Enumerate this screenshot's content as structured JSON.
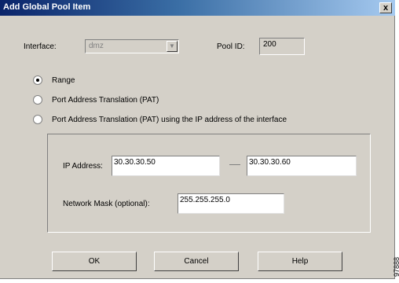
{
  "window": {
    "title": "Add Global Pool Item",
    "close_label": "x"
  },
  "interface": {
    "label": "Interface:",
    "value": "dmz",
    "arrow": "▼"
  },
  "pool": {
    "label": "Pool ID:",
    "value": "200"
  },
  "options": [
    {
      "label": "Range",
      "checked": true
    },
    {
      "label": "Port Address Translation (PAT)",
      "checked": false
    },
    {
      "label": "Port Address Translation (PAT) using the IP address of the interface",
      "checked": false
    }
  ],
  "ip": {
    "label": "IP Address:",
    "start": "30.30.30.50",
    "end": "30.30.30.60"
  },
  "mask": {
    "label": "Network Mask (optional):",
    "value": "255.255.255.0"
  },
  "buttons": {
    "ok": "OK",
    "cancel": "Cancel",
    "help": "Help"
  },
  "figure_id": "97888"
}
